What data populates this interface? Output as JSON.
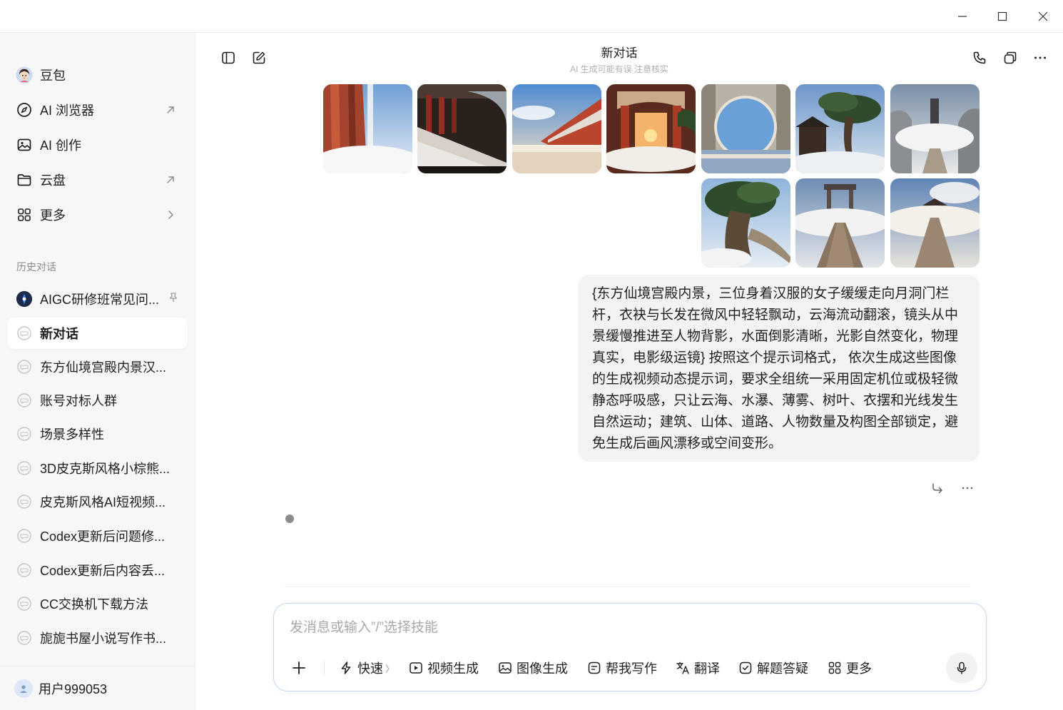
{
  "app": {
    "name": "豆包"
  },
  "sidebar": {
    "nav": [
      {
        "label": "豆包",
        "icon": "avatar-icon"
      },
      {
        "label": "AI 浏览器",
        "icon": "compass-icon",
        "trail": "external-arrow-icon"
      },
      {
        "label": "AI 创作",
        "icon": "image-icon"
      },
      {
        "label": "云盘",
        "icon": "folder-icon",
        "trail": "external-arrow-icon"
      },
      {
        "label": "更多",
        "icon": "grid-icon",
        "trail": "chevron-right-icon"
      }
    ],
    "history_title": "历史对话",
    "history": [
      {
        "label": "AIGC研修班常见问...",
        "pinned": true
      },
      {
        "label": "新对话",
        "active": true
      },
      {
        "label": "东方仙境宫殿内景汉..."
      },
      {
        "label": "账号对标人群"
      },
      {
        "label": "场景多样性"
      },
      {
        "label": "3D皮克斯风格小棕熊..."
      },
      {
        "label": "皮克斯风格AI短视频..."
      },
      {
        "label": "Codex更新后问题修..."
      },
      {
        "label": "Codex更新后内容丢..."
      },
      {
        "label": "CC交换机下载方法"
      },
      {
        "label": "旎旎书屋小说写作书..."
      }
    ],
    "user": {
      "name": "用户999053"
    }
  },
  "header": {
    "title": "新对话",
    "subtitle": "AI 生成可能有误 注意核实"
  },
  "message": {
    "text": "{东方仙境宫殿内景，三位身着汉服的女子缓缓走向月洞门栏杆，衣袂与长发在微风中轻轻飘动，云海流动翻滚，镜头从中景缓慢推进至人物背影，水面倒影清晰，光影自然变化，物理真实，电影级运镜} 按照这个提示词格式， 依次生成这些图像的生成视频动态提示词，要求全组统一采用固定机位或极轻微静态呼吸感，只让云海、水瀑、薄雾、树叶、衣摆和光线发生自然运动；建筑、山体、道路、人物数量及构图全部锁定，避免生成后画风漂移或空间变形。"
  },
  "composer": {
    "placeholder": "发消息或输入”/”选择技能",
    "tools": [
      {
        "label": "快速",
        "icon": "lightning-icon",
        "suffix": "〉"
      },
      {
        "label": "视频生成",
        "icon": "video-icon"
      },
      {
        "label": "图像生成",
        "icon": "image-icon"
      },
      {
        "label": "帮我写作",
        "icon": "write-icon"
      },
      {
        "label": "翻译",
        "icon": "translate-icon"
      },
      {
        "label": "解题答疑",
        "icon": "solve-icon"
      },
      {
        "label": "更多",
        "icon": "grid-icon"
      }
    ]
  },
  "colors": {
    "accent_border": "#c6d6f2",
    "sidebar_bg": "#f7f7f8",
    "bubble_bg": "#f3f3f4"
  }
}
